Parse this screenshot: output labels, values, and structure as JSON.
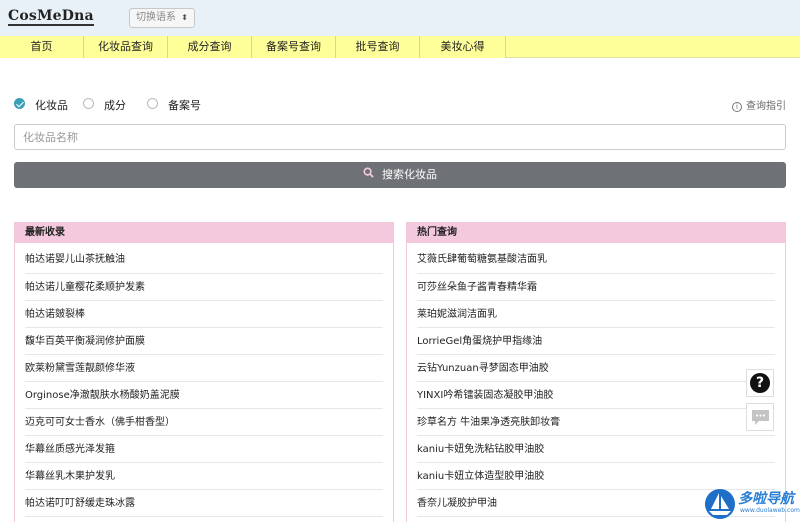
{
  "header": {
    "logo": "CosMeDna",
    "language_select": "切换语系"
  },
  "nav": {
    "items": [
      "首页",
      "化妆品查询",
      "成分查询",
      "备案号查询",
      "批号查询",
      "美妆心得"
    ]
  },
  "search": {
    "options": [
      {
        "label": "化妆品",
        "selected": true
      },
      {
        "label": "成分",
        "selected": false
      },
      {
        "label": "备案号",
        "selected": false
      }
    ],
    "guide_label": "查询指引",
    "placeholder": "化妆品名称",
    "value": "",
    "button_label": "搜索化妆品"
  },
  "latest": {
    "title": "最新收录",
    "items": [
      "帕达诺婴儿山茶抚触油",
      "帕达诺儿童樱花柔顺护发素",
      "帕达诺皴裂棒",
      "馥华百英平衡凝润修护面膜",
      "欧莱粉黛雪莲靓颜修华液",
      "Orginose净澈靓肤水杨酸奶盖泥膜",
      "迈克可可女士香水（佛手柑香型）",
      "华幕丝质感光泽发箍",
      "华幕丝乳木果护发乳",
      "帕达诺叮叮舒缓走珠冰露"
    ]
  },
  "popular": {
    "title": "热门查询",
    "items": [
      "艾薇氏肆葡萄糖氨基酸洁面乳",
      "可莎丝朵鱼子酱青春精华霜",
      "莱珀妮滋润洁面乳",
      "LorrieGel角蛋烧护甲指缘油",
      "云钻Yunzuan寻梦固态甲油胶",
      "YINXI吟希镭装固态凝胶甲油胶",
      "珍草名方 牛油果净透亮肤卸妆膏",
      "kaniu卡妞免洗粘钻胶甲油胶",
      "kaniu卡妞立体造型胶甲油胶",
      "香奈儿凝胶护甲油"
    ]
  },
  "watermark": {
    "name": "多啦导航",
    "url": "www.duolaweb.com"
  },
  "colors": {
    "nav_bg": "#ffff99",
    "panel_head": "#f4c8dd",
    "button_bg": "#6e7276",
    "accent": "#3aa0b8"
  }
}
